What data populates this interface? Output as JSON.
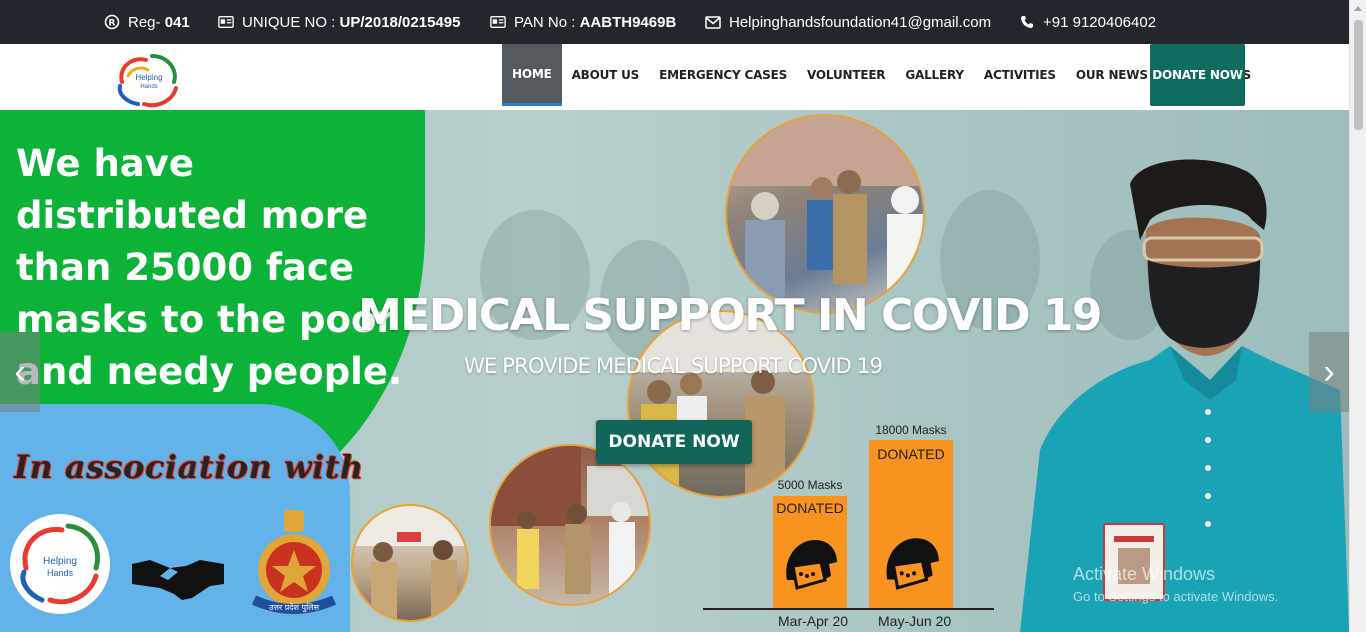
{
  "topbar": {
    "reg_label": "Reg- ",
    "reg_value": "041",
    "unique_label": "UNIQUE NO : ",
    "unique_value": "UP/2018/0215495",
    "pan_label": "PAN No : ",
    "pan_value": "AABTH9469B",
    "email": "Helpinghandsfoundation41@gmail.com",
    "phone": "+91 9120406402"
  },
  "nav": {
    "logo_text_1": "Helping",
    "logo_text_2": "Hands",
    "items": [
      "HOME",
      "ABOUT US",
      "EMERGENCY CASES",
      "VOLUNTEER",
      "GALLERY",
      "ACTIVITIES",
      "OUR NEWS",
      "CONTACT US"
    ],
    "active": "HOME",
    "donate_label": "DONATE NOW"
  },
  "hero": {
    "green_text": "We have distributed more than 25000 face masks to the poor and needy people.",
    "association_text": "In association with",
    "title": "MEDICAL SUPPORT IN COVID 19",
    "subtitle": "WE PROVIDE MEDICAL SUPPORT COVID 19",
    "donate_label": "DONATE NOW",
    "prev_arrow": "‹",
    "next_arrow": "›",
    "partner_logo_text_1": "Helping",
    "partner_logo_text_2": "Hands",
    "police_text": "उत्तर प्रदेश पुलिस"
  },
  "mask_chart": {
    "bars": [
      {
        "period": "Mar-Apr 20",
        "amount_label": "5000 Masks",
        "status": "DONATED",
        "value": 5000
      },
      {
        "period": "May-Jun 20",
        "amount_label": "18000 Masks",
        "status": "DONATED",
        "value": 18000
      }
    ],
    "color": "#f7931e"
  },
  "watermark": {
    "line1": "Activate Windows",
    "line2": "Go to Settings to activate Windows."
  },
  "colors": {
    "topbar": "#23262d",
    "nav_active": "#555a5f",
    "donate": "#0f6b5d",
    "green_panel": "#0db339",
    "blue_panel": "#63b3ea"
  }
}
